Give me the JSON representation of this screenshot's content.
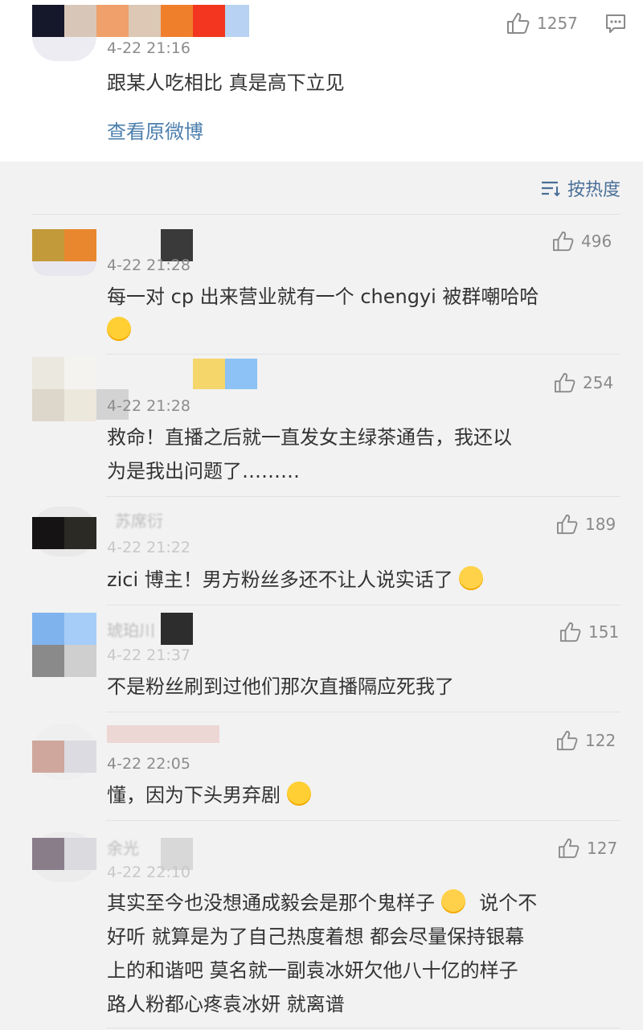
{
  "top_comment": {
    "time": "4-22 21:16",
    "likes": "1257",
    "text": "跟某人吃相比 真是高下立见",
    "view_original": "查看原微博"
  },
  "sort": {
    "label": "按热度",
    "icon": "sort-lines-icon"
  },
  "comments": [
    {
      "time": "4-22 21:28",
      "likes": "496",
      "text_lines": [
        "每一对 cp 出来营业就有一个 chengyi 被群嘲哈哈"
      ],
      "emoji": "laughing-tears-emoji"
    },
    {
      "time": "4-22 21:28",
      "likes": "254",
      "text_lines": [
        "救命！直播之后就一直发女主绿茶通告，我还以",
        "为是我出问题了………"
      ]
    },
    {
      "name_partial": "苏席衍",
      "time": "4-22 21:22",
      "likes": "189",
      "text_lines": [
        "zici 博主！男方粉丝多还不让人说实话了"
      ],
      "emoji": "sweat-emoji"
    },
    {
      "name_partial": "琥珀川",
      "time": "4-22 21:37",
      "likes": "151",
      "text_lines": [
        "不是粉丝刷到过他们那次直播隔应死我了"
      ]
    },
    {
      "time": "4-22 22:05",
      "likes": "122",
      "text_lines": [
        "懂，因为下头男弃剧"
      ],
      "emoji": "thinking-emoji"
    },
    {
      "name_partial": "余光",
      "time": "4-22 22:10",
      "likes": "127",
      "text_lines": [
        "其实至今也没想通成毅会是那个鬼样子",
        "好听 就算是为了自己热度着想 都会尽量保持银幕",
        "上的和谐吧 莫名就一副袁冰妍欠他八十亿的样子",
        "路人粉都心疼袁冰妍 就离谱"
      ],
      "line1_suffix": "说个不",
      "emoji": "crying-emoji"
    }
  ],
  "colors": {
    "link": "#4c7fad",
    "sort": "#4a6f98",
    "meta": "#8c8c8c",
    "text": "#333333"
  }
}
